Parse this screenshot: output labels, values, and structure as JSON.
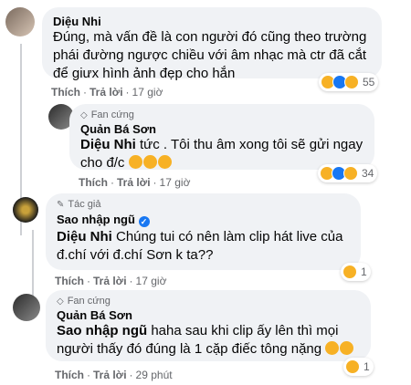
{
  "comments": [
    {
      "author": "Diệu Nhi",
      "text": "Đúng, mà vấn đề là con người đó cũng theo trường phái đường ngược chiều với âm nhạc mà ctr đã cắt để giưx hình ảnh đẹp cho hắn",
      "actions": {
        "like": "Thích",
        "reply": "Trả lời",
        "time": "17 giờ"
      },
      "reactions": {
        "icons": [
          "haha-icon",
          "like-icon",
          "wow-icon"
        ],
        "count": "55"
      }
    },
    {
      "badge": "Fan cứng",
      "author": "Quản Bá Sơn",
      "tag": "Diệu Nhi",
      "text": " tức . Tôi thu âm xong tôi sẽ gửi ngay cho đ/c ",
      "actions": {
        "like": "Thích",
        "reply": "Trả lời",
        "time": "17 giờ"
      },
      "reactions": {
        "icons": [
          "haha-icon",
          "like-icon",
          "wow-icon"
        ],
        "count": "34"
      }
    },
    {
      "badge": "Tác giả",
      "author": "Sao nhập ngũ",
      "tag": "Diệu Nhi",
      "text": " Chúng tui có nên làm clip hát live của đ.chí với đ.chí Sơn k ta??",
      "actions": {
        "like": "Thích",
        "reply": "Trả lời",
        "time": "17 giờ"
      },
      "reactions": {
        "icons": [
          "thinking-icon"
        ],
        "count": "1"
      }
    },
    {
      "badge": "Fan cứng",
      "author": "Quản Bá Sơn",
      "tag": "Sao nhập ngũ",
      "text": " haha sau khi clip ấy lên thì mọi người thấy đó đúng là 1 cặp điếc tông nặng ",
      "actions": {
        "like": "Thích",
        "reply": "Trả lời",
        "time": "29 phút"
      },
      "reactions": {
        "icons": [
          "haha-icon"
        ],
        "count": "1"
      }
    }
  ],
  "colors": {
    "bubble": "#f0f2f5",
    "link": "#050505",
    "meta": "#65676b",
    "verified": "#1877f2"
  }
}
